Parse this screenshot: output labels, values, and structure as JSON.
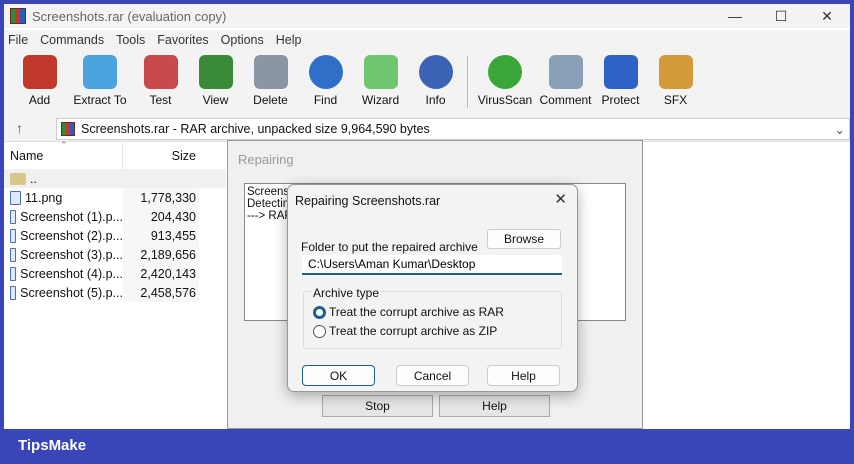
{
  "window": {
    "title": "Screenshots.rar (evaluation copy)"
  },
  "menu": [
    "File",
    "Commands",
    "Tools",
    "Favorites",
    "Options",
    "Help"
  ],
  "toolbar": [
    {
      "label": "Add",
      "icon": "add-icon",
      "color": "#c0392b"
    },
    {
      "label": "Extract To",
      "icon": "folder-extract-icon",
      "color": "#4aa3df"
    },
    {
      "label": "Test",
      "icon": "test-clipboard-icon",
      "color": "#c94a4a"
    },
    {
      "label": "View",
      "icon": "book-icon",
      "color": "#3a8a3a"
    },
    {
      "label": "Delete",
      "icon": "trash-icon",
      "color": "#8a96a3"
    },
    {
      "label": "Find",
      "icon": "magnifier-icon",
      "color": "#2f6fc7"
    },
    {
      "label": "Wizard",
      "icon": "wand-icon",
      "color": "#6fc76f"
    },
    {
      "label": "Info",
      "icon": "info-icon",
      "color": "#3b62b5"
    },
    {
      "label": "VirusScan",
      "icon": "virus-icon",
      "color": "#3aa63a"
    },
    {
      "label": "Comment",
      "icon": "comment-icon",
      "color": "#8aa0b8"
    },
    {
      "label": "Protect",
      "icon": "shield-icon",
      "color": "#2f62c7"
    },
    {
      "label": "SFX",
      "icon": "sfx-box-icon",
      "color": "#d49a3a"
    }
  ],
  "address": {
    "text": "Screenshots.rar - RAR archive, unpacked size 9,964,590 bytes"
  },
  "list": {
    "headers": {
      "name": "Name",
      "size": "Size"
    },
    "parent": "..",
    "rows": [
      {
        "name": "11.png",
        "size": "1,778,330"
      },
      {
        "name": "Screenshot (1).p...",
        "size": "204,430"
      },
      {
        "name": "Screenshot (2).p...",
        "size": "913,455"
      },
      {
        "name": "Screenshot (3).p...",
        "size": "2,189,656"
      },
      {
        "name": "Screenshot (4).p...",
        "size": "2,420,143"
      },
      {
        "name": "Screenshot (5).p...",
        "size": "2,458,576"
      }
    ]
  },
  "repairing": {
    "title": "Repairing",
    "log": [
      "Screensh",
      "Detectin",
      "---> RAR"
    ],
    "stop": "Stop",
    "help": "Help"
  },
  "dialog": {
    "title": "Repairing Screenshots.rar",
    "folder_label": "Folder to put the repaired archive",
    "browse": "Browse",
    "path": "C:\\Users\\Aman Kumar\\Desktop",
    "group_label": "Archive type",
    "options": [
      "Treat the corrupt archive as RAR",
      "Treat the corrupt archive as ZIP"
    ],
    "selected": 0,
    "ok": "OK",
    "cancel": "Cancel",
    "help": "Help"
  },
  "brand": "TipsMake"
}
